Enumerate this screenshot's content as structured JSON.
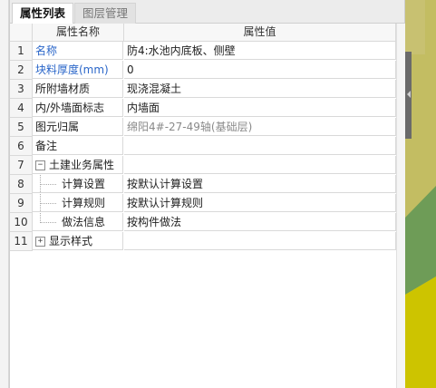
{
  "tabs": [
    {
      "label": "属性列表",
      "active": true
    },
    {
      "label": "图层管理",
      "active": false
    }
  ],
  "columns": {
    "name": "属性名称",
    "value": "属性值"
  },
  "rows": [
    {
      "num": "1",
      "name": "名称",
      "value": "防4:水池内底板、侧壁",
      "name_color": "blue"
    },
    {
      "num": "2",
      "name": "块料厚度(mm)",
      "value": "0",
      "name_color": "blue"
    },
    {
      "num": "3",
      "name": "所附墙材质",
      "value": "现浇混凝土"
    },
    {
      "num": "4",
      "name": "内/外墙面标志",
      "value": "内墙面"
    },
    {
      "num": "5",
      "name": "图元归属",
      "value": "绵阳4#-27-49轴(基础层)",
      "value_color": "grey"
    },
    {
      "num": "6",
      "name": "备注",
      "value": ""
    },
    {
      "num": "7",
      "name": "土建业务属性",
      "value": "",
      "group": "expanded",
      "toggle": "−"
    },
    {
      "num": "8",
      "name": "计算设置",
      "value": "按默认计算设置",
      "child": true
    },
    {
      "num": "9",
      "name": "计算规则",
      "value": "按默认计算规则",
      "child": true
    },
    {
      "num": "10",
      "name": "做法信息",
      "value": "按构件做法",
      "child": true
    },
    {
      "num": "11",
      "name": "显示样式",
      "value": "",
      "group": "collapsed",
      "toggle": "+"
    }
  ],
  "colors": {
    "blue_label": "#2a66c9",
    "grey_value": "#8a8a8a",
    "side_background": "#c3bd62"
  }
}
